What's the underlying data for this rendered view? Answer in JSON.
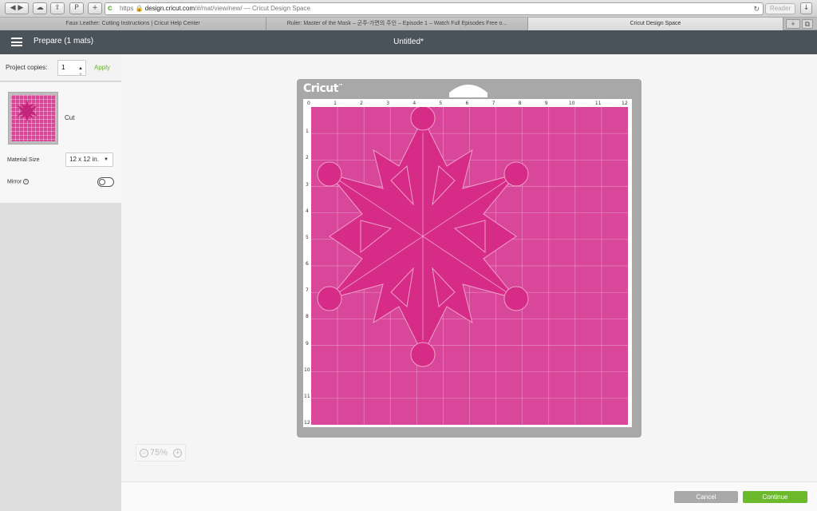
{
  "browser": {
    "url_scheme": "https",
    "url_host": "design.cricut.com",
    "url_path": "/#/mat/view/new/",
    "page_title_suffix": " — Cricut Design Space",
    "reader_label": "Reader",
    "tabs": [
      {
        "label": "Faux Leather: Cutting Instructions | Cricut Help Center",
        "active": false
      },
      {
        "label": "Ruler: Master of the Mask – 군주-가면의 주인 – Episode 1 – Watch Full Episodes Free o...",
        "active": false
      },
      {
        "label": "Cricut Design Space",
        "active": true
      }
    ],
    "new_tab_label": "+"
  },
  "header": {
    "prepare_label": "Prepare (1 mats)",
    "project_title": "Untitled*"
  },
  "left_panel": {
    "copies_label": "Project copies:",
    "copies_value": "1",
    "apply_label": "Apply",
    "mat_label": "Cut",
    "material_size_label": "Material Size",
    "material_size_value": "12 x 12 in.",
    "mirror_label": "Mirror",
    "mirror_on": false
  },
  "mat": {
    "brand": "Cricut",
    "color": "#d9479a",
    "ruler_top": [
      "0",
      "1",
      "2",
      "3",
      "4",
      "5",
      "6",
      "7",
      "8",
      "9",
      "10",
      "11",
      "12"
    ],
    "ruler_left": [
      "1",
      "2",
      "3",
      "4",
      "5",
      "6",
      "7",
      "8",
      "9",
      "10",
      "11",
      "12"
    ]
  },
  "zoom": {
    "minus": "−",
    "value": "75%",
    "plus": "+"
  },
  "footer": {
    "cancel_label": "Cancel",
    "continue_label": "Continue"
  },
  "colors": {
    "accent_green": "#6cb92b",
    "header_bg": "#4a535a",
    "snowflake": "#d62b87"
  }
}
